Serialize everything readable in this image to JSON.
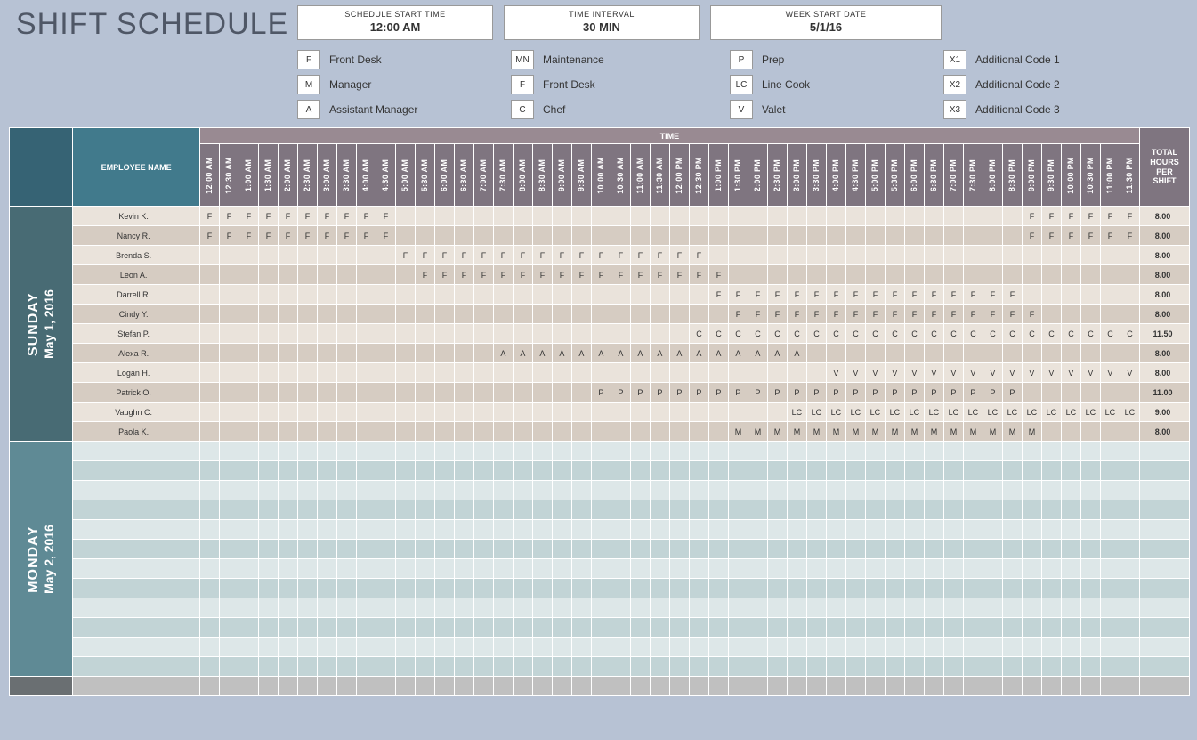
{
  "title": "SHIFT SCHEDULE",
  "settings": [
    {
      "label": "SCHEDULE START TIME",
      "value": "12:00 AM"
    },
    {
      "label": "TIME INTERVAL",
      "value": "30 MIN"
    },
    {
      "label": "WEEK START DATE",
      "value": "5/1/16"
    }
  ],
  "legend": [
    {
      "col": 0,
      "row": 0,
      "code": "F",
      "label": "Front Desk"
    },
    {
      "col": 0,
      "row": 1,
      "code": "M",
      "label": "Manager"
    },
    {
      "col": 0,
      "row": 2,
      "code": "A",
      "label": "Assistant Manager"
    },
    {
      "col": 1,
      "row": 0,
      "code": "MN",
      "label": "Maintenance"
    },
    {
      "col": 1,
      "row": 1,
      "code": "F",
      "label": "Front Desk"
    },
    {
      "col": 1,
      "row": 2,
      "code": "C",
      "label": "Chef"
    },
    {
      "col": 2,
      "row": 0,
      "code": "P",
      "label": "Prep"
    },
    {
      "col": 2,
      "row": 1,
      "code": "LC",
      "label": "Line Cook"
    },
    {
      "col": 2,
      "row": 2,
      "code": "V",
      "label": "Valet"
    },
    {
      "col": 3,
      "row": 0,
      "code": "X1",
      "label": "Additional Code 1"
    },
    {
      "col": 3,
      "row": 1,
      "code": "X2",
      "label": "Additional Code 2"
    },
    {
      "col": 3,
      "row": 2,
      "code": "X3",
      "label": "Additional Code 3"
    }
  ],
  "legendColX": [
    0,
    240,
    486,
    726
  ],
  "legendRowY": [
    0,
    28,
    56
  ],
  "headers": {
    "employee": "EMPLOYEE NAME",
    "time": "TIME",
    "total": "TOTAL HOURS PER SHIFT"
  },
  "times": [
    "12:00 AM",
    "12:30 AM",
    "1:00 AM",
    "1:30 AM",
    "2:00 AM",
    "2:30 AM",
    "3:00 AM",
    "3:30 AM",
    "4:00 AM",
    "4:30 AM",
    "5:00 AM",
    "5:30 AM",
    "6:00 AM",
    "6:30 AM",
    "7:00 AM",
    "7:30 AM",
    "8:00 AM",
    "8:30 AM",
    "9:00 AM",
    "9:30 AM",
    "10:00 AM",
    "10:30 AM",
    "11:00 AM",
    "11:30 AM",
    "12:00 PM",
    "12:30 PM",
    "1:00 PM",
    "1:30 PM",
    "2:00 PM",
    "2:30 PM",
    "3:00 PM",
    "3:30 PM",
    "4:00 PM",
    "4:30 PM",
    "5:00 PM",
    "5:30 PM",
    "6:00 PM",
    "6:30 PM",
    "7:00 PM",
    "7:30 PM",
    "8:00 PM",
    "8:30 PM",
    "9:00 PM",
    "9:30 PM",
    "10:00 PM",
    "10:30 PM",
    "11:00 PM",
    "11:30 PM"
  ],
  "days": [
    {
      "key": "sun",
      "dow": "SUNDAY",
      "date": "May 1, 2016",
      "dayClass": "day-sun",
      "rows": [
        {
          "name": "Kevin K.",
          "total": "8.00",
          "code": "F",
          "ranges": [
            [
              0,
              9
            ],
            [
              42,
              47
            ]
          ]
        },
        {
          "name": "Nancy R.",
          "total": "8.00",
          "code": "F",
          "ranges": [
            [
              0,
              9
            ],
            [
              42,
              47
            ]
          ]
        },
        {
          "name": "Brenda S.",
          "total": "8.00",
          "code": "F",
          "ranges": [
            [
              10,
              25
            ]
          ]
        },
        {
          "name": "Leon A.",
          "total": "8.00",
          "code": "F",
          "ranges": [
            [
              11,
              26
            ]
          ]
        },
        {
          "name": "Darrell R.",
          "total": "8.00",
          "code": "F",
          "ranges": [
            [
              26,
              41
            ]
          ]
        },
        {
          "name": "Cindy Y.",
          "total": "8.00",
          "code": "F",
          "ranges": [
            [
              27,
              42
            ]
          ]
        },
        {
          "name": "Stefan P.",
          "total": "11.50",
          "code": "C",
          "ranges": [
            [
              25,
              47
            ]
          ]
        },
        {
          "name": "Alexa R.",
          "total": "8.00",
          "code": "A",
          "ranges": [
            [
              15,
              30
            ]
          ]
        },
        {
          "name": "Logan H.",
          "total": "8.00",
          "code": "V",
          "ranges": [
            [
              32,
              47
            ]
          ]
        },
        {
          "name": "Patrick O.",
          "total": "11.00",
          "code": "P",
          "ranges": [
            [
              20,
              41
            ]
          ]
        },
        {
          "name": "Vaughn C.",
          "total": "9.00",
          "code": "LC",
          "ranges": [
            [
              30,
              47
            ]
          ]
        },
        {
          "name": "Paola K.",
          "total": "8.00",
          "code": "M",
          "ranges": [
            [
              27,
              42
            ]
          ]
        }
      ]
    },
    {
      "key": "mon",
      "dow": "MONDAY",
      "date": "May 2, 2016",
      "dayClass": "day-mon",
      "rows": [
        {
          "name": "",
          "total": ""
        },
        {
          "name": "",
          "total": ""
        },
        {
          "name": "",
          "total": ""
        },
        {
          "name": "",
          "total": ""
        },
        {
          "name": "",
          "total": ""
        },
        {
          "name": "",
          "total": ""
        },
        {
          "name": "",
          "total": ""
        },
        {
          "name": "",
          "total": ""
        },
        {
          "name": "",
          "total": ""
        },
        {
          "name": "",
          "total": ""
        },
        {
          "name": "",
          "total": ""
        },
        {
          "name": "",
          "total": ""
        }
      ]
    },
    {
      "key": "tue",
      "dow": "",
      "date": "",
      "dayClass": "day-tue",
      "rows": [
        {
          "name": "",
          "total": ""
        }
      ]
    }
  ]
}
